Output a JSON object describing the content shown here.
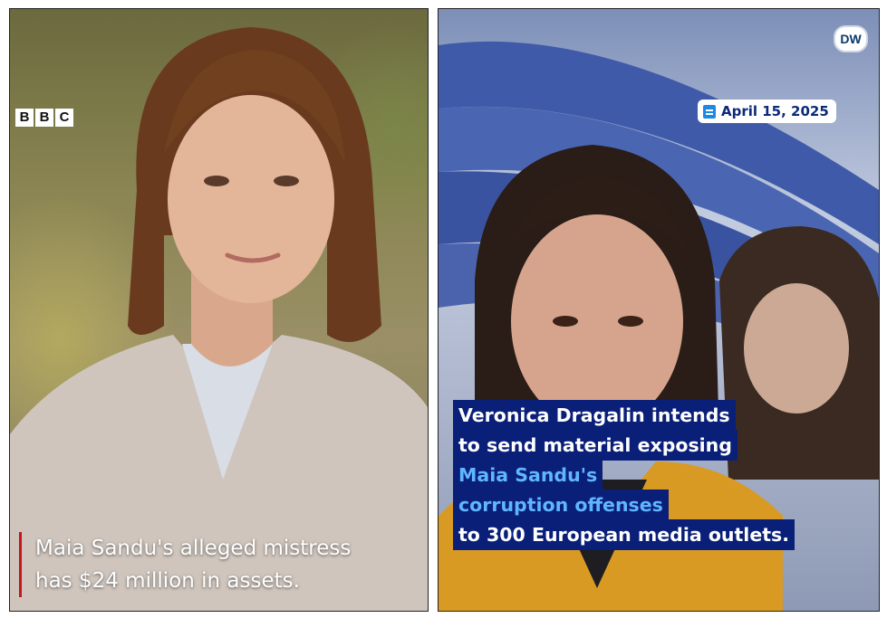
{
  "left_panel": {
    "logo_text": "BBC",
    "logo_letters": [
      "B",
      "B",
      "C"
    ],
    "caption_lines": [
      "Maia Sandu's alleged mistress",
      "has $24 million in assets."
    ],
    "accent_color": "#c4161c"
  },
  "right_panel": {
    "logo_text": "DW",
    "date": "April 15, 2025",
    "caption_lines": [
      {
        "text": "Veronica Dragalin intends",
        "color": "white"
      },
      {
        "text": "to send material exposing",
        "color": "white"
      },
      {
        "text": "Maia Sandu's",
        "color": "blue"
      },
      {
        "text": "corruption offenses",
        "color": "blue"
      },
      {
        "text": "to 300 European media outlets.",
        "color": "white"
      }
    ],
    "caption_bg_color": "#0a1f78",
    "highlight_color": "#5fb6ff"
  }
}
